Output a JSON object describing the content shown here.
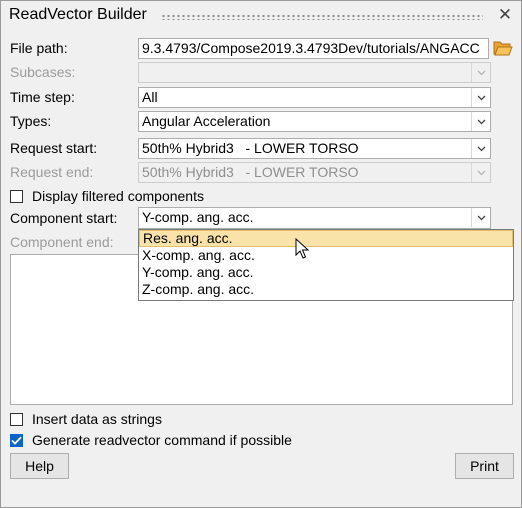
{
  "window": {
    "title": "ReadVector Builder"
  },
  "form": {
    "file_path": {
      "label": "File path:",
      "value": "9.3.4793/Compose2019.3.4793Dev/tutorials/ANGACC"
    },
    "subcases": {
      "label": "Subcases:",
      "value": ""
    },
    "time_step": {
      "label": "Time step:",
      "value": "All"
    },
    "types": {
      "label": "Types:",
      "value": "Angular Acceleration"
    },
    "request_start": {
      "label": "Request start:",
      "value": "50th% Hybrid3   - LOWER TORSO"
    },
    "request_end": {
      "label": "Request end:",
      "value": "50th% Hybrid3   - LOWER TORSO"
    },
    "display_filtered": {
      "label": "Display filtered components",
      "checked": false
    },
    "component_start": {
      "label": "Component start:",
      "value": "Y-comp. ang. acc."
    },
    "component_end": {
      "label": "Component end:"
    }
  },
  "dropdown": {
    "items": [
      "Res. ang. acc.",
      "X-comp. ang. acc.",
      "Y-comp. ang. acc.",
      "Z-comp. ang. acc."
    ],
    "highlighted_index": 0
  },
  "options": {
    "insert_strings": {
      "label": "Insert data as strings",
      "checked": false
    },
    "generate_cmd": {
      "label": "Generate readvector command if possible",
      "checked": true
    }
  },
  "buttons": {
    "help": "Help",
    "print": "Print"
  },
  "colors": {
    "highlight": "#f9e3a8",
    "checkbox_accent": "#0a64c8",
    "folder": "#e8a23a"
  },
  "icons": {
    "close": "close-icon",
    "folder": "folder-open-icon",
    "arrow": "chevron-down-icon"
  }
}
